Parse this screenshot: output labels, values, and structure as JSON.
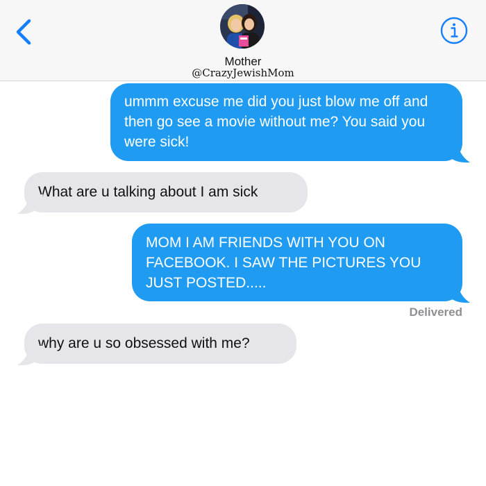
{
  "header": {
    "contact_name": "Mother",
    "contact_handle": "@CrazyJewishMom",
    "back_icon": "chevron-left-icon",
    "info_icon": "info-icon"
  },
  "messages": [
    {
      "direction": "sent",
      "text": "ummm excuse me did you just blow me off and then go see a movie without me? You said you were sick!"
    },
    {
      "direction": "received",
      "text": "What are u talking about I am sick"
    },
    {
      "direction": "sent",
      "text": "MOM I AM FRIENDS WITH YOU ON FACEBOOK. I SAW THE PICTURES YOU JUST POSTED....."
    },
    {
      "direction": "received",
      "text": "why are u so obsessed with me?"
    }
  ],
  "status": {
    "delivered_label": "Delivered"
  },
  "colors": {
    "accent": "#147efb",
    "sent_bubble": "#1f9bf2",
    "received_bubble": "#e5e5ea",
    "header_bg": "#f7f7f8",
    "status_text": "#8e8e93"
  }
}
